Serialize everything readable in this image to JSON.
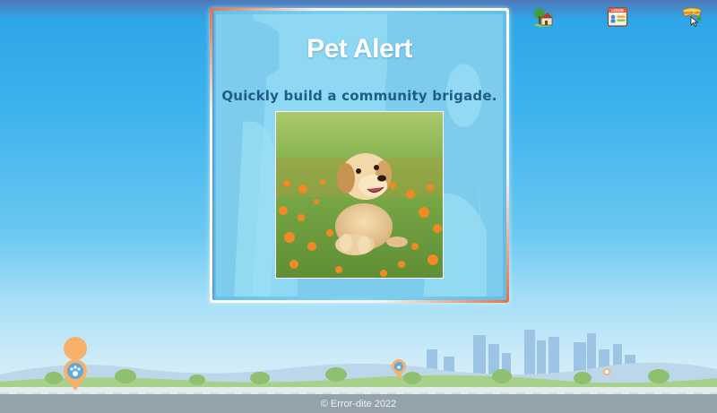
{
  "nav": {
    "icons": [
      "home-icon",
      "login-icon",
      "signup-icon"
    ],
    "login_icon_text": "LOGIN",
    "signup_icon_text": "SIGN UP"
  },
  "hero": {
    "title": "Pet Alert",
    "subtitle": "Quickly build a community brigade.",
    "image_subject": "puppy-photo"
  },
  "footer": {
    "copyright": "© Error-dite 2022"
  },
  "colors": {
    "sky_top": "#4f78b8",
    "sky": "#3db2ec",
    "card_accent": "#e8703a",
    "subtitle": "#1e5d86",
    "map_pin": "#f09a3e"
  }
}
